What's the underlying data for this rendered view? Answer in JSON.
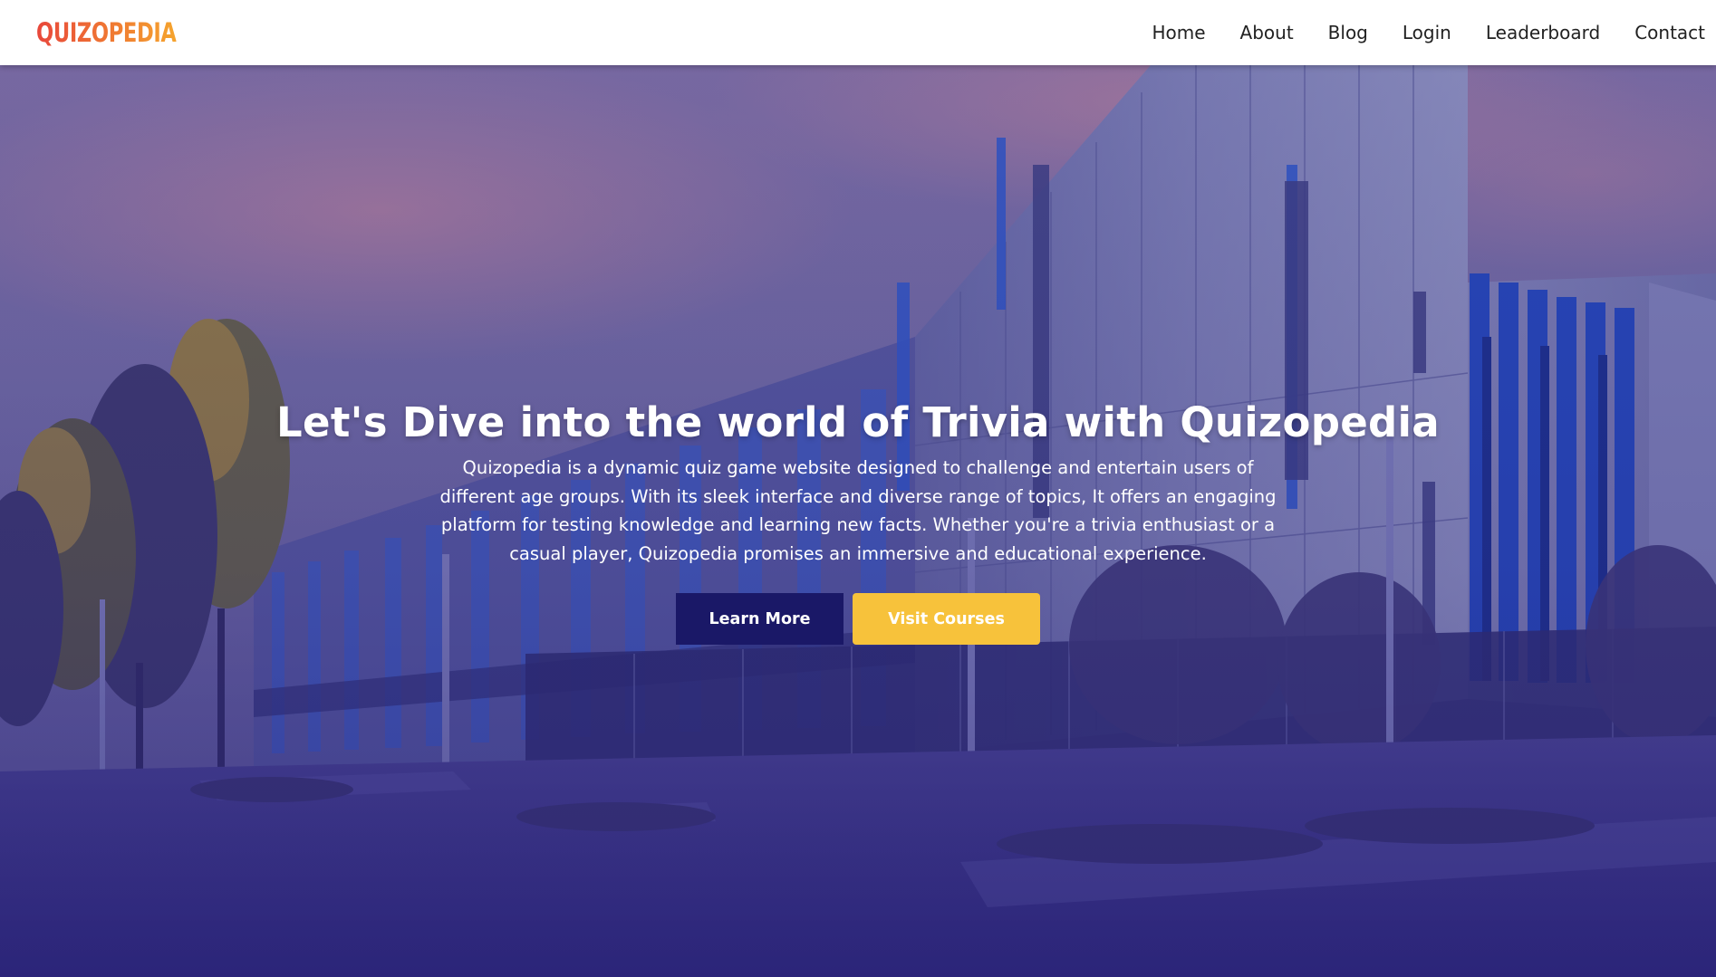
{
  "brand": {
    "logo_text": "QUIZOPEDIA",
    "logo_colors": [
      "#e8473b",
      "#f07a32",
      "#f5a42e"
    ]
  },
  "nav": {
    "items": [
      {
        "label": "Home"
      },
      {
        "label": "About"
      },
      {
        "label": "Blog"
      },
      {
        "label": "Login"
      },
      {
        "label": "Leaderboard"
      },
      {
        "label": "Contact"
      }
    ]
  },
  "hero": {
    "background_image": "modern-campus-building-photo",
    "overlay_color": "#3a3290",
    "title": "Let's Dive into the world of Trivia with Quizopedia",
    "description": "Quizopedia is a dynamic quiz game website designed to challenge and entertain users of different age groups. With its sleek interface and diverse range of topics, It offers an engaging platform for testing knowledge and learning new facts. Whether you're a trivia enthusiast or a casual player, Quizopedia promises an immersive and educational experience.",
    "buttons": {
      "learn_more": "Learn More",
      "visit_courses": "Visit Courses"
    },
    "button_colors": {
      "learn_more_bg": "#1a1867",
      "visit_courses_bg": "#f7c23b"
    }
  }
}
